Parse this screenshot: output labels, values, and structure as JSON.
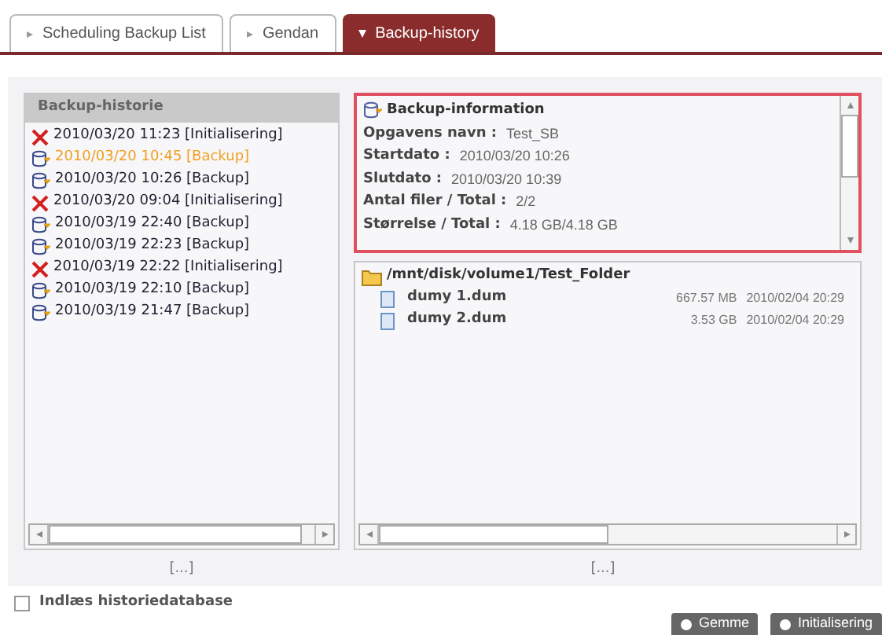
{
  "tabs": [
    {
      "label": "Scheduling Backup List",
      "selected": false
    },
    {
      "label": "Gendan",
      "selected": false
    },
    {
      "label": "Backup-history",
      "selected": true
    }
  ],
  "history": {
    "title": "Backup-historie",
    "items": [
      {
        "kind": "error",
        "label": "2010/03/20 11:23 [Initialisering]",
        "selected": false
      },
      {
        "kind": "backup",
        "label": "2010/03/20 10:45 [Backup]",
        "selected": true
      },
      {
        "kind": "backup",
        "label": "2010/03/20 10:26 [Backup]",
        "selected": false
      },
      {
        "kind": "error",
        "label": "2010/03/20 09:04 [Initialisering]",
        "selected": false
      },
      {
        "kind": "backup",
        "label": "2010/03/19 22:40 [Backup]",
        "selected": false
      },
      {
        "kind": "backup",
        "label": "2010/03/19 22:23 [Backup]",
        "selected": false
      },
      {
        "kind": "error",
        "label": "2010/03/19 22:22 [Initialisering]",
        "selected": false
      },
      {
        "kind": "backup",
        "label": "2010/03/19 22:10 [Backup]",
        "selected": false
      },
      {
        "kind": "backup",
        "label": "2010/03/19 21:47 [Backup]",
        "selected": false
      }
    ],
    "more": "[...]"
  },
  "info": {
    "title": "Backup-information",
    "fields": [
      {
        "label": "Opgavens navn :",
        "value": "Test_SB"
      },
      {
        "label": "Startdato :",
        "value": "2010/03/20 10:26"
      },
      {
        "label": "Slutdato :",
        "value": "2010/03/20 10:39"
      },
      {
        "label": "Antal filer / Total :",
        "value": "2/2"
      },
      {
        "label": "Størrelse / Total :",
        "value": "4.18 GB/4.18 GB"
      }
    ]
  },
  "files": {
    "folder": "/mnt/disk/volume1/Test_Folder",
    "items": [
      {
        "name": "dumy 1.dum",
        "size": "667.57 MB",
        "date": "2010/02/04 20:29"
      },
      {
        "name": "dumy 2.dum",
        "size": "3.53 GB",
        "date": "2010/02/04 20:29"
      }
    ],
    "more": "[...]"
  },
  "load_history": {
    "label": "Indlæs historiedatabase",
    "checked": false
  },
  "buttons": [
    "Gemme",
    "Initialisering"
  ]
}
